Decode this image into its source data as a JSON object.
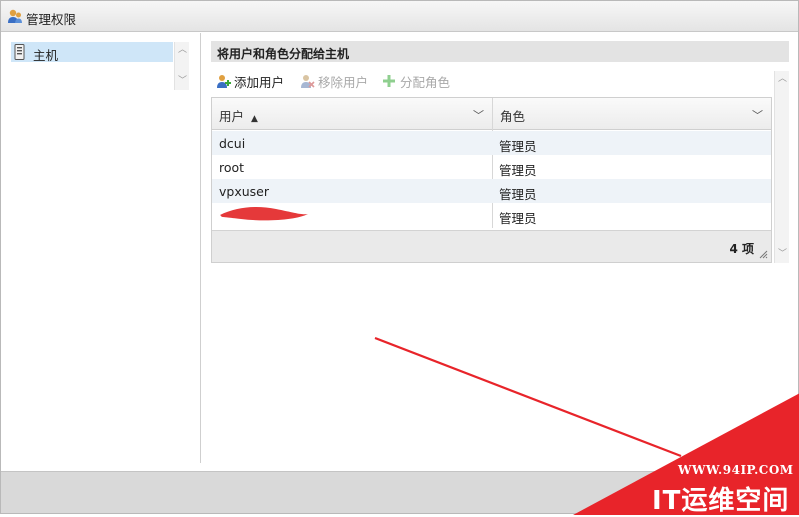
{
  "window": {
    "title": "管理权限",
    "title_icon": "users-icon"
  },
  "tree": {
    "items": [
      {
        "label": "主机",
        "icon": "host-icon",
        "selected": true
      }
    ]
  },
  "panel": {
    "header": "将用户和角色分配给主机"
  },
  "toolbar": {
    "add_user": {
      "label": "添加用户",
      "icon": "add-user-icon",
      "enabled": true
    },
    "remove_user": {
      "label": "移除用户",
      "icon": "remove-user-icon",
      "enabled": false
    },
    "assign_role": {
      "label": "分配角色",
      "icon": "plus-icon",
      "enabled": false
    }
  },
  "table": {
    "columns": [
      {
        "label": "用户",
        "sort": "▲"
      },
      {
        "label": "角色"
      }
    ],
    "rows": [
      {
        "user": "dcui",
        "role": "管理员"
      },
      {
        "user": "root",
        "role": "管理员"
      },
      {
        "user": "vpxuser",
        "role": "管理员"
      },
      {
        "user": "",
        "role": "管理员"
      }
    ],
    "footer_count": "4 项"
  },
  "watermark": {
    "url": "WWW.94IP.COM",
    "text": "IT运维空间"
  },
  "colors": {
    "selection": "#cfe6f8",
    "alt_row": "#eef3f8",
    "watermark_red": "#e8242a"
  }
}
